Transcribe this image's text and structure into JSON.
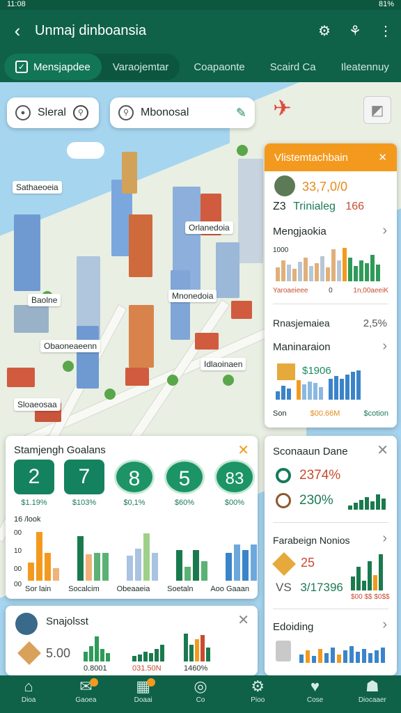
{
  "status": {
    "left": "11:08",
    "right": "81%"
  },
  "appbar": {
    "title": "Unmaj dinboansia"
  },
  "tabs": [
    "Mensjapdee",
    "Varaojemtar",
    "Coapaonte",
    "Scaird Ca",
    "Ileatennuy"
  ],
  "search": {
    "left": "Sleral",
    "right": "Mbonosal"
  },
  "map_labels": [
    "Sathaeoeia",
    "Orlanedoia",
    "Mnonedoia",
    "Baolne",
    "Obaoneaeenn",
    "Idlaoinaen",
    "Sloaeosaa"
  ],
  "right_panel": {
    "header": "Vlistemtachbain",
    "value1": "33,7,0/0",
    "subline_a": "Z3",
    "subline_b": "Trinialeg",
    "subline_c": "166",
    "sec1": "Mengjaokia",
    "axis_left": "1000",
    "axis_a": "Yaroaeieee",
    "axis_b": "0",
    "axis_c": "1n,00aeeiK",
    "sec2": "Rnasjemaiea",
    "sec2_value": "2,5%",
    "sec3": "Maninaraion",
    "sec3_value": "$1906",
    "sec3_left": "Son",
    "sec3_mid": "$00.66M",
    "sec3_right": "$cotion"
  },
  "stats_card": {
    "title": "Stamjengh Goalans",
    "items": [
      {
        "num": "2",
        "pct": "$1.19%"
      },
      {
        "num": "7",
        "pct": "$103%"
      },
      {
        "num": "8",
        "pct": "$0,1%"
      },
      {
        "num": "5",
        "pct": "$60%"
      },
      {
        "num": "83",
        "pct": "$00%"
      }
    ],
    "y_label": "16 /look",
    "y_ticks": [
      "00",
      "10",
      "00",
      "00"
    ],
    "x_labels": [
      "Sor lain",
      "Socalcim",
      "Obeaaeia",
      "Soetaln",
      "Aoo Gaaan"
    ]
  },
  "side_card": {
    "title": "Sconaaun Dane",
    "val1": "2374%",
    "val2": "230%",
    "sec2": "Farabeign Nonios",
    "val3": "25",
    "val4_a": "VS",
    "val4_b": "3/17396",
    "axis": "$00 $$ $0$$",
    "sec3": "Edoiding"
  },
  "profile_card": {
    "title": "Snajolsst",
    "value": "5.00",
    "l1": "0.8001",
    "l2": "031.50N",
    "l3": "1460%"
  },
  "nav": [
    "Dioa",
    "Gaoea",
    "Doaai",
    "Co",
    "Pioo",
    "Cose",
    "Diocaaer"
  ],
  "colors": {
    "primary": "#0f6148",
    "accent": "#f39a1e",
    "green": "#14825e",
    "red": "#c84b2f"
  }
}
